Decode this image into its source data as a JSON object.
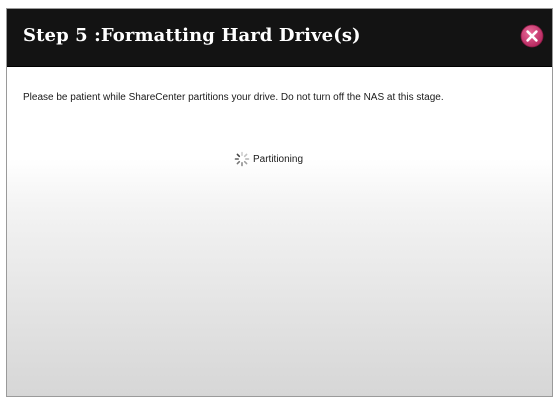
{
  "dialog": {
    "title": "Step 5 :Formatting Hard Drive(s)",
    "close_icon": "close-icon",
    "message": "Please be patient while ShareCenter partitions your drive. Do not turn off the NAS at this stage.",
    "status": {
      "icon": "spinner-icon",
      "text": "Partitioning"
    }
  },
  "colors": {
    "titlebar_bg": "#131313",
    "title_text": "#ffffff",
    "close_button": "#c8326e",
    "body_text": "#1a1a1a"
  }
}
